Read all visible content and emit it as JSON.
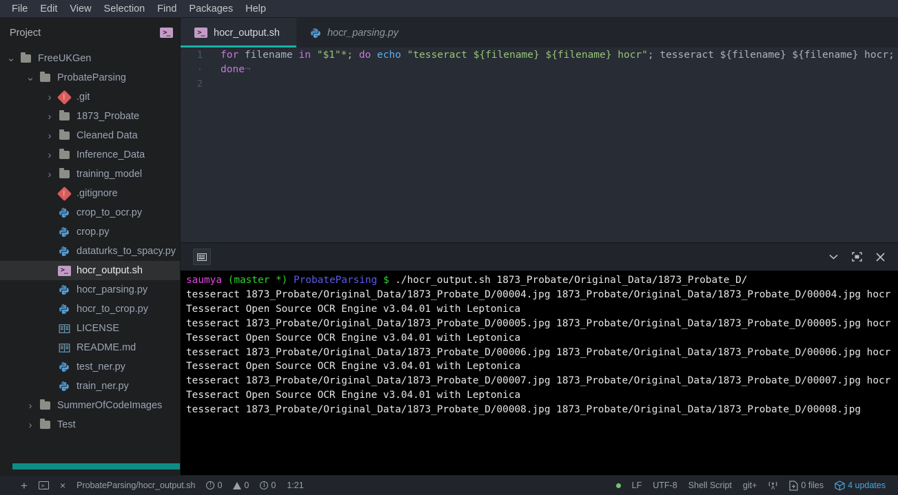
{
  "menubar": {
    "items": [
      "File",
      "Edit",
      "View",
      "Selection",
      "Find",
      "Packages",
      "Help"
    ]
  },
  "sidebar": {
    "header": "Project",
    "header_icon": "shell-script-icon",
    "tree": [
      {
        "label": "FreeUKGen",
        "depth": 0,
        "chevron": "down",
        "icon": "folder"
      },
      {
        "label": "ProbateParsing",
        "depth": 1,
        "chevron": "down",
        "icon": "folder"
      },
      {
        "label": ".git",
        "depth": 2,
        "chevron": "right",
        "icon": "git"
      },
      {
        "label": "1873_Probate",
        "depth": 2,
        "chevron": "right",
        "icon": "folder"
      },
      {
        "label": "Cleaned Data",
        "depth": 2,
        "chevron": "right",
        "icon": "folder"
      },
      {
        "label": "Inference_Data",
        "depth": 2,
        "chevron": "right",
        "icon": "folder"
      },
      {
        "label": "training_model",
        "depth": 2,
        "chevron": "right",
        "icon": "folder"
      },
      {
        "label": ".gitignore",
        "depth": 2,
        "chevron": "none",
        "icon": "git"
      },
      {
        "label": "crop_to_ocr.py",
        "depth": 2,
        "chevron": "none",
        "icon": "python"
      },
      {
        "label": "crop.py",
        "depth": 2,
        "chevron": "none",
        "icon": "python"
      },
      {
        "label": "dataturks_to_spacy.py",
        "depth": 2,
        "chevron": "none",
        "icon": "python"
      },
      {
        "label": "hocr_output.sh",
        "depth": 2,
        "chevron": "none",
        "icon": "shell",
        "selected": true
      },
      {
        "label": "hocr_parsing.py",
        "depth": 2,
        "chevron": "none",
        "icon": "python"
      },
      {
        "label": "hocr_to_crop.py",
        "depth": 2,
        "chevron": "none",
        "icon": "python"
      },
      {
        "label": "LICENSE",
        "depth": 2,
        "chevron": "none",
        "icon": "book"
      },
      {
        "label": "README.md",
        "depth": 2,
        "chevron": "none",
        "icon": "book"
      },
      {
        "label": "test_ner.py",
        "depth": 2,
        "chevron": "none",
        "icon": "python"
      },
      {
        "label": "train_ner.py",
        "depth": 2,
        "chevron": "none",
        "icon": "python"
      },
      {
        "label": "SummerOfCodeImages",
        "depth": 1,
        "chevron": "right",
        "icon": "folder"
      },
      {
        "label": "Test",
        "depth": 1,
        "chevron": "right",
        "icon": "folder"
      }
    ]
  },
  "tabs": [
    {
      "label": "hocr_output.sh",
      "icon": "shell-script-icon",
      "active": true,
      "preview": false
    },
    {
      "label": "hocr_parsing.py",
      "icon": "python-icon",
      "active": false,
      "preview": true
    }
  ],
  "editor": {
    "lines": [
      {
        "number": "1",
        "fold": false
      },
      {
        "number": "·",
        "fold": true
      },
      {
        "number": "2",
        "fold": false
      }
    ],
    "code": {
      "l1_for": "for",
      "l1_filename": " filename ",
      "l1_in": "in",
      "l1_arg": " \"$1\"*; ",
      "l1_do": "do",
      "l1_echo": " echo ",
      "l1_str": "\"tesseract ${filename} ${filename} hocr\"",
      "l1_semi": "; tesseract ${filename} ${filename} hocr;",
      "l2_done": "done",
      "l2_mark": "¬"
    }
  },
  "terminal": {
    "toolbar": {
      "tab_icon": "keyboard-icon",
      "collapse_icon": "chevron-down-icon",
      "maximize_icon": "maximize-icon",
      "close_icon": "close-icon"
    },
    "prompt": {
      "user": "saumya",
      "branch": "(master *)",
      "dir": "ProbateParsing",
      "symbol": "$",
      "command": " ./hocr_output.sh 1873_Probate/Original_Data/1873_Probate_D/"
    },
    "output": [
      "tesseract 1873_Probate/Original_Data/1873_Probate_D/00004.jpg 1873_Probate/Original_Data/1873_Probate_D/00004.jpg hocr",
      "Tesseract Open Source OCR Engine v3.04.01 with Leptonica",
      "tesseract 1873_Probate/Original_Data/1873_Probate_D/00005.jpg 1873_Probate/Original_Data/1873_Probate_D/00005.jpg hocr",
      "Tesseract Open Source OCR Engine v3.04.01 with Leptonica",
      "tesseract 1873_Probate/Original_Data/1873_Probate_D/00006.jpg 1873_Probate/Original_Data/1873_Probate_D/00006.jpg hocr",
      "Tesseract Open Source OCR Engine v3.04.01 with Leptonica",
      "tesseract 1873_Probate/Original_Data/1873_Probate_D/00007.jpg 1873_Probate/Original_Data/1873_Probate_D/00007.jpg hocr",
      "Tesseract Open Source OCR Engine v3.04.01 with Leptonica",
      "tesseract 1873_Probate/Original_Data/1873_Probate_D/00008.jpg 1873_Probate/Original_Data/1873_Probate_D/00008.jpg"
    ]
  },
  "statusbar": {
    "add_label": "+",
    "close_label": "×",
    "path": "ProbateParsing/hocr_output.sh",
    "errors": "0",
    "warnings": "0",
    "info": "0",
    "cursor": "1:21",
    "line_ending": "LF",
    "encoding": "UTF-8",
    "grammar": "Shell Script",
    "git": "git+",
    "files_changed": "0 files",
    "updates": "4 updates"
  },
  "colors": {
    "accent": "#15b3a6",
    "scrollbar": "#0f8c86",
    "updates": "#4aa3df",
    "menubar_bg": "#2b303b",
    "sidebar_bg": "#1d1f21",
    "editor_bg": "#282c34",
    "terminal_bg": "#000000"
  }
}
